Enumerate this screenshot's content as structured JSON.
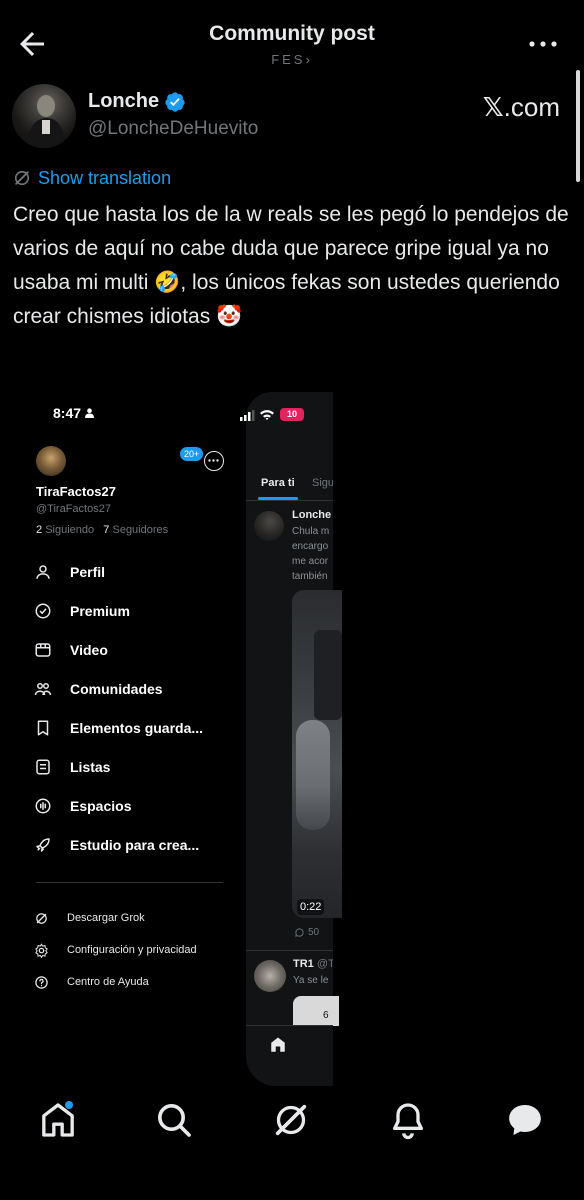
{
  "header": {
    "title": "Community post",
    "subtitle": "FES›"
  },
  "author": {
    "name": "Lonche",
    "handle": "@LoncheDeHuevito",
    "verified": true
  },
  "watermark": {
    "logo": "𝕏",
    "suffix": ".com"
  },
  "translate": {
    "label": "Show translation"
  },
  "post": {
    "text": "Creo que hasta los de la w reals se les pegó lo pendejos de varios de aquí no cabe duda que parece gripe igual ya no usaba mi multi 🤣, los únicos fekas son ustedes queriendo crear chismes idiotas 🤡"
  },
  "embed": {
    "status": {
      "time": "8:47",
      "battery": "10"
    },
    "drawer": {
      "name": "TiraFactos27",
      "handle": "@TiraFactos27",
      "following_count": "2",
      "following_label": "Siguiendo",
      "followers_count": "7",
      "followers_label": "Seguidores",
      "accounts_badge": "20+",
      "menu": [
        {
          "label": "Perfil",
          "icon": "person-icon"
        },
        {
          "label": "Premium",
          "icon": "premium-icon"
        },
        {
          "label": "Video",
          "icon": "video-icon"
        },
        {
          "label": "Comunidades",
          "icon": "communities-icon"
        },
        {
          "label": "Elementos guarda...",
          "icon": "bookmark-icon"
        },
        {
          "label": "Listas",
          "icon": "lists-icon"
        },
        {
          "label": "Espacios",
          "icon": "spaces-icon"
        },
        {
          "label": "Estudio para crea...",
          "icon": "rocket-icon"
        }
      ],
      "secondary": [
        {
          "label": "Descargar Grok",
          "icon": "grok-icon"
        },
        {
          "label": "Configuración y privacidad",
          "icon": "gear-icon"
        },
        {
          "label": "Centro de Ayuda",
          "icon": "help-icon"
        }
      ]
    },
    "feed": {
      "tab_active": "Para ti",
      "tab_inactive": "Sigu",
      "post1": {
        "name": "Lonche",
        "lines": [
          "Chula m",
          "encargo",
          "me acor",
          "también"
        ],
        "video_time": "0:22",
        "replies": "50"
      },
      "post2": {
        "name": "TR1",
        "handle": "@T",
        "text": "Ya se le",
        "card_text": "6"
      }
    }
  },
  "colors": {
    "background": "#000000",
    "accent": "#1d9bf0",
    "text_primary": "#e7e9ea",
    "text_secondary": "#71767b",
    "battery": "#e0245e"
  },
  "nav": {
    "items": [
      "home-icon",
      "search-icon",
      "grok-icon",
      "notifications-icon",
      "messages-icon"
    ]
  }
}
